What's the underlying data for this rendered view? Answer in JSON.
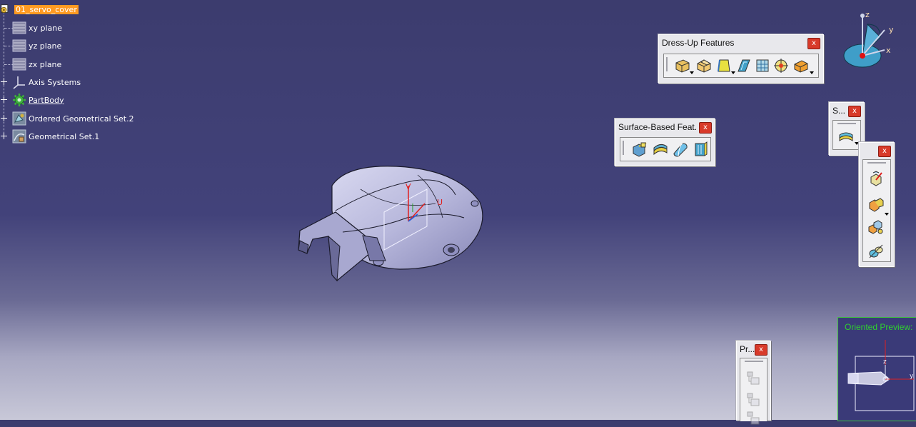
{
  "spec_tree": {
    "root": "01_servo_cover",
    "items": [
      {
        "label": "xy plane",
        "icon": "plane-icon"
      },
      {
        "label": "yz plane",
        "icon": "plane-icon"
      },
      {
        "label": "zx plane",
        "icon": "plane-icon"
      },
      {
        "label": "Axis Systems",
        "icon": "axis-system-icon"
      },
      {
        "label": "PartBody",
        "icon": "partbody-gear-icon"
      },
      {
        "label": "Ordered Geometrical Set.2",
        "icon": "ordered-geoset-icon"
      },
      {
        "label": "Geometrical Set.1",
        "icon": "geoset-icon"
      }
    ]
  },
  "compass": {
    "x": "x",
    "y": "y",
    "z": "z"
  },
  "toolbars": {
    "dressup": {
      "title": "Dress-Up Features",
      "close": "x",
      "buttons": [
        "edge-fillet-icon",
        "chamfer-icon",
        "draft-icon",
        "shell-icon",
        "thickness-icon",
        "thread-icon",
        "remove-face-icon"
      ]
    },
    "surface": {
      "title": "Surface-Based Feat...",
      "close": "x",
      "buttons": [
        "split-icon",
        "thick-surface-icon",
        "close-surface-icon",
        "sew-surface-icon"
      ]
    },
    "s": {
      "title": "S...",
      "close": "x",
      "buttons": [
        "sketch-based-icon"
      ]
    },
    "transform": {
      "title": "",
      "close": "x",
      "buttons": [
        "translation-icon",
        "mirror-icon",
        "pattern-icon",
        "scaling-icon"
      ]
    },
    "pr": {
      "title": "Pr...",
      "close": "x",
      "buttons": [
        "product-icon",
        "product-icon",
        "product-icon"
      ]
    }
  },
  "preview": {
    "title": "Oriented Preview:"
  },
  "colors": {
    "selection": "#ff9a22",
    "background_top": "#3c3c6e",
    "background_bottom": "#c8c8d8",
    "preview_title": "#2fd02f"
  }
}
